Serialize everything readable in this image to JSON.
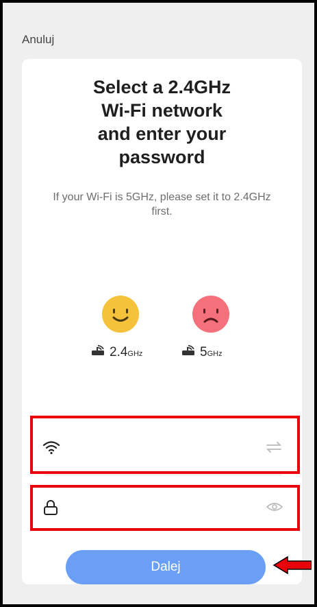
{
  "header": {
    "cancel_label": "Anuluj"
  },
  "main": {
    "title_lines": [
      "Select a 2.4GHz",
      "Wi-Fi network",
      "and enter your",
      "password"
    ],
    "subtitle": "If your Wi-Fi is 5GHz, please set it to 2.4GHz first.",
    "bands": [
      {
        "value": "2.4",
        "unit": "GHz",
        "mood": "happy",
        "color": "#f5c33b"
      },
      {
        "value": "5",
        "unit": "GHz",
        "mood": "sad",
        "color": "#f4717c"
      }
    ],
    "wifi_field": {
      "value": "",
      "lead_icon": "wifi-icon",
      "trail_icon": "switch-network-icon"
    },
    "password_field": {
      "value": "",
      "lead_icon": "lock-icon",
      "trail_icon": "eye-icon"
    },
    "next_label": "Dalej"
  },
  "annotations": {
    "highlight_color": "#e8000b",
    "arrow_color": "#e8000b"
  },
  "colors": {
    "accent": "#6b9ff5",
    "background": "#efefef",
    "card": "#ffffff"
  }
}
